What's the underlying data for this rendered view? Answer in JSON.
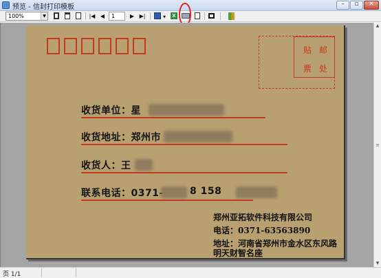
{
  "window": {
    "title": "预览 - 信封打印模板",
    "min_label": "–",
    "max_label": "▫",
    "close_label": "✕"
  },
  "toolbar": {
    "zoom_value": "100%",
    "page_number": "1",
    "buttons": [
      {
        "name": "single-page-button",
        "icon": "page-icon"
      },
      {
        "name": "two-page-button",
        "icon": "pages-icon"
      },
      {
        "name": "page-setup-button",
        "icon": "doc-icon"
      },
      {
        "name": "first-page-button",
        "icon": "first-page-icon"
      },
      {
        "name": "prev-page-button",
        "icon": "prev-page-icon"
      },
      {
        "name": "next-page-button",
        "icon": "next-page-icon"
      },
      {
        "name": "last-page-button",
        "icon": "last-page-icon"
      },
      {
        "name": "save-button",
        "icon": "save-icon"
      },
      {
        "name": "export-excel-button",
        "icon": "excel-icon"
      },
      {
        "name": "print-button",
        "icon": "printer-icon"
      },
      {
        "name": "blank-page-button",
        "icon": "doc-icon"
      },
      {
        "name": "stop-button",
        "icon": "stop-icon"
      },
      {
        "name": "exit-button",
        "icon": "exit-icon"
      }
    ],
    "glyphs": {
      "first": "|◀",
      "prev": "◀",
      "next": "▶",
      "last": "▶|",
      "dropdown": "▼"
    }
  },
  "envelope": {
    "stamp_chars": [
      "贴",
      "邮",
      "票",
      "处"
    ],
    "fields": [
      {
        "label": "收货单位：星",
        "tail": ""
      },
      {
        "label": "收货地址：郑州市",
        "tail": ""
      },
      {
        "label": "收货人：王",
        "tail": ""
      },
      {
        "label": "联系电话：0371-",
        "tail": "8  158"
      }
    ],
    "sender": {
      "company": "郑州亚拓软件科技有限公司",
      "phone": "电话：0371-63563890",
      "address_line1": "地址：河南省郑州市金水区东风路",
      "address_line2": "明天财智名座"
    }
  },
  "statusbar": {
    "page_info": "页 1/1"
  },
  "colors": {
    "envelope_paper": "#b9a071",
    "stamp_red": "#c7391e",
    "highlight": "#e02020"
  }
}
